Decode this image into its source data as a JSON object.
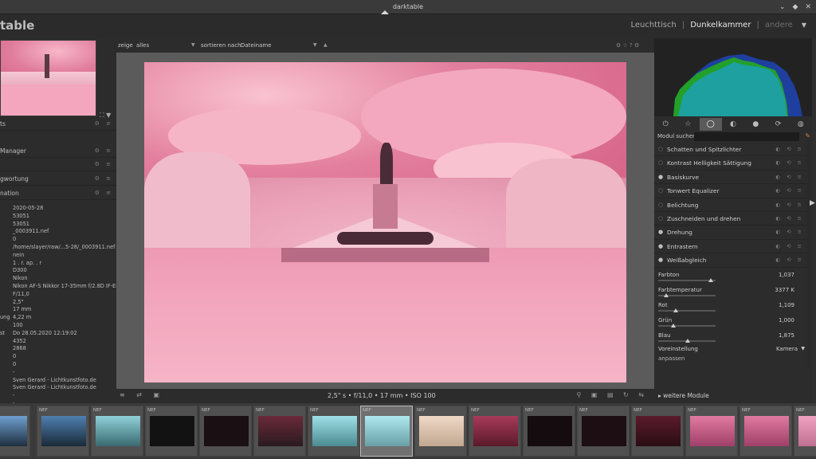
{
  "window": {
    "title": "darktable",
    "controls": [
      "⌄",
      "◆",
      "✕"
    ]
  },
  "header": {
    "logo": "table",
    "views": {
      "lighttable": "Leuchttisch",
      "darkroom": "Dunkelkammer",
      "other": "andere",
      "sep": "|"
    }
  },
  "center_toolbar": {
    "show_label": "zeige",
    "show_value": "alles",
    "sort_label": "sortieren nach",
    "sort_value": "Dateiname",
    "sort_dir": "▲"
  },
  "left_panel": {
    "sections": [
      {
        "label": "ts"
      },
      {
        "label": "Manager"
      },
      {
        "label": ""
      },
      {
        "label": "gwortung"
      },
      {
        "label": "nation"
      }
    ],
    "info": [
      {
        "k": "",
        "v": "2020-05-28"
      },
      {
        "k": "",
        "v": "53051"
      },
      {
        "k": "",
        "v": "53051"
      },
      {
        "k": "",
        "v": "_0003911.nef"
      },
      {
        "k": "",
        "v": "0"
      },
      {
        "k": "",
        "v": "/home/slayer/raw/...5-28/_0003911.nef"
      },
      {
        "k": "",
        "v": "nein"
      },
      {
        "k": "",
        "v": "1 . r. ap. . r"
      },
      {
        "k": "",
        "v": "D300"
      },
      {
        "k": "",
        "v": "Nikon"
      },
      {
        "k": "",
        "v": "Nikon AF-S Nikkor 17-35mm f/2.8D IF-ED"
      },
      {
        "k": "",
        "v": "F/11,0"
      },
      {
        "k": "",
        "v": "2,5\""
      },
      {
        "k": "",
        "v": "17 mm"
      },
      {
        "k": "ung",
        "v": "4,22 m"
      },
      {
        "k": "",
        "v": "100"
      },
      {
        "k": "st",
        "v": "Do 28.05.2020 12:19:02"
      },
      {
        "k": "",
        "v": "4352"
      },
      {
        "k": "",
        "v": "2868"
      },
      {
        "k": "",
        "v": "0"
      },
      {
        "k": "",
        "v": "0"
      },
      {
        "k": "",
        "v": "-"
      },
      {
        "k": "",
        "v": "Sven Gerard - Lichtkunstfoto.de"
      },
      {
        "k": "",
        "v": "Sven Gerard - Lichtkunstfoto.de"
      },
      {
        "k": "",
        "v": "-"
      },
      {
        "k": "",
        "v": "-"
      },
      {
        "k": "",
        "v": "-"
      },
      {
        "k": "",
        "v": "-"
      },
      {
        "k": "",
        "v": "-"
      }
    ]
  },
  "center_bottom": {
    "exposure_info": "2,5\" s • f/11,0 • 17 mm • ISO 100"
  },
  "right_panel": {
    "search_label": "Modul suchen",
    "search_value": "",
    "module_groups": [
      "⏻",
      "☆",
      "◯",
      "◐",
      "●",
      "⟳",
      "◍"
    ],
    "modules": [
      {
        "name": "Schatten und Spitzlichter",
        "on": false
      },
      {
        "name": "Kontrast Helligkeit Sättigung",
        "on": false
      },
      {
        "name": "Basiskurve",
        "on": true
      },
      {
        "name": "Tonwert Equalizer",
        "on": false
      },
      {
        "name": "Belichtung",
        "on": false
      },
      {
        "name": "Zuschneiden und drehen",
        "on": false
      },
      {
        "name": "Drehung",
        "on": true
      },
      {
        "name": "Entrastern",
        "on": true
      },
      {
        "name": "Weißabgleich",
        "on": true
      }
    ],
    "white_balance": {
      "farbton": {
        "label": "Farbton",
        "value": "1,037",
        "pos": 0.92
      },
      "farbtemperatur": {
        "label": "Farbtemperatur",
        "value": "3377 K",
        "pos": 0.14
      },
      "rot": {
        "label": "Rot",
        "value": "1,109",
        "pos": 0.3
      },
      "gruen": {
        "label": "Grün",
        "value": "1,000",
        "pos": 0.27
      },
      "blau": {
        "label": "Blau",
        "value": "1,875",
        "pos": 0.52
      },
      "preset_label": "Voreinstellung",
      "preset_value": "Kamera",
      "adjust_label": "anpassen"
    },
    "more_modules": "weitere Module"
  },
  "filmstrip": {
    "raw_label": "NEF"
  },
  "colors": {
    "accent": "#d88040",
    "bg": "#2f2f2f"
  }
}
